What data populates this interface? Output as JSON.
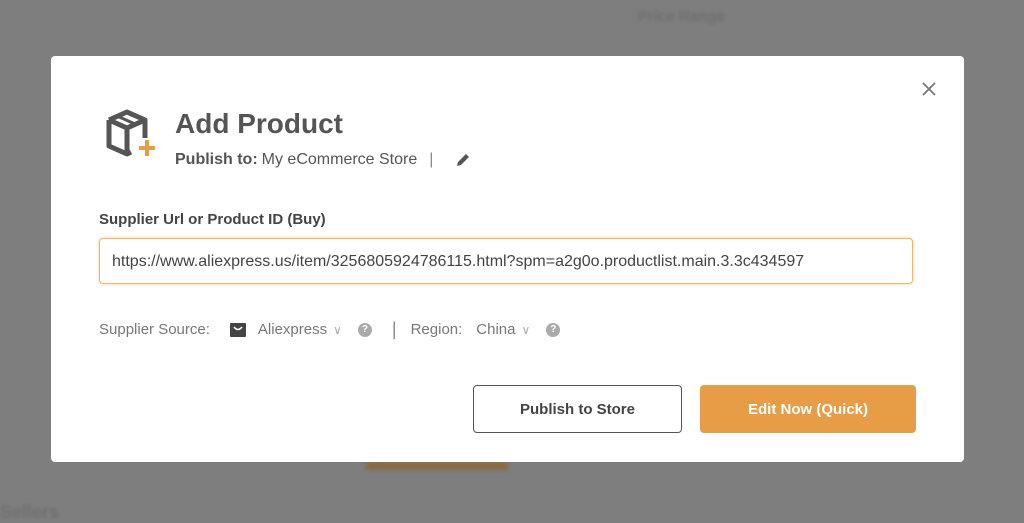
{
  "background": {
    "heading": "Price Range",
    "footer": "Sellers"
  },
  "modal": {
    "title": "Add Product",
    "publish_label": "Publish to:",
    "publish_store": "My eCommerce Store",
    "separator": "|",
    "url_label": "Supplier Url or Product ID (Buy)",
    "url_value": "https://www.aliexpress.us/item/3256805924786115.html?spm=a2g0o.productlist.main.3.3c434597",
    "supplier_source_label": "Supplier Source:",
    "supplier_source_value": "Aliexpress",
    "region_label": "Region:",
    "region_value": "China",
    "help": "?",
    "publish_button": "Publish to Store",
    "edit_button": "Edit Now (Quick)"
  },
  "colors": {
    "accent": "#e79d46",
    "text": "#555555"
  }
}
